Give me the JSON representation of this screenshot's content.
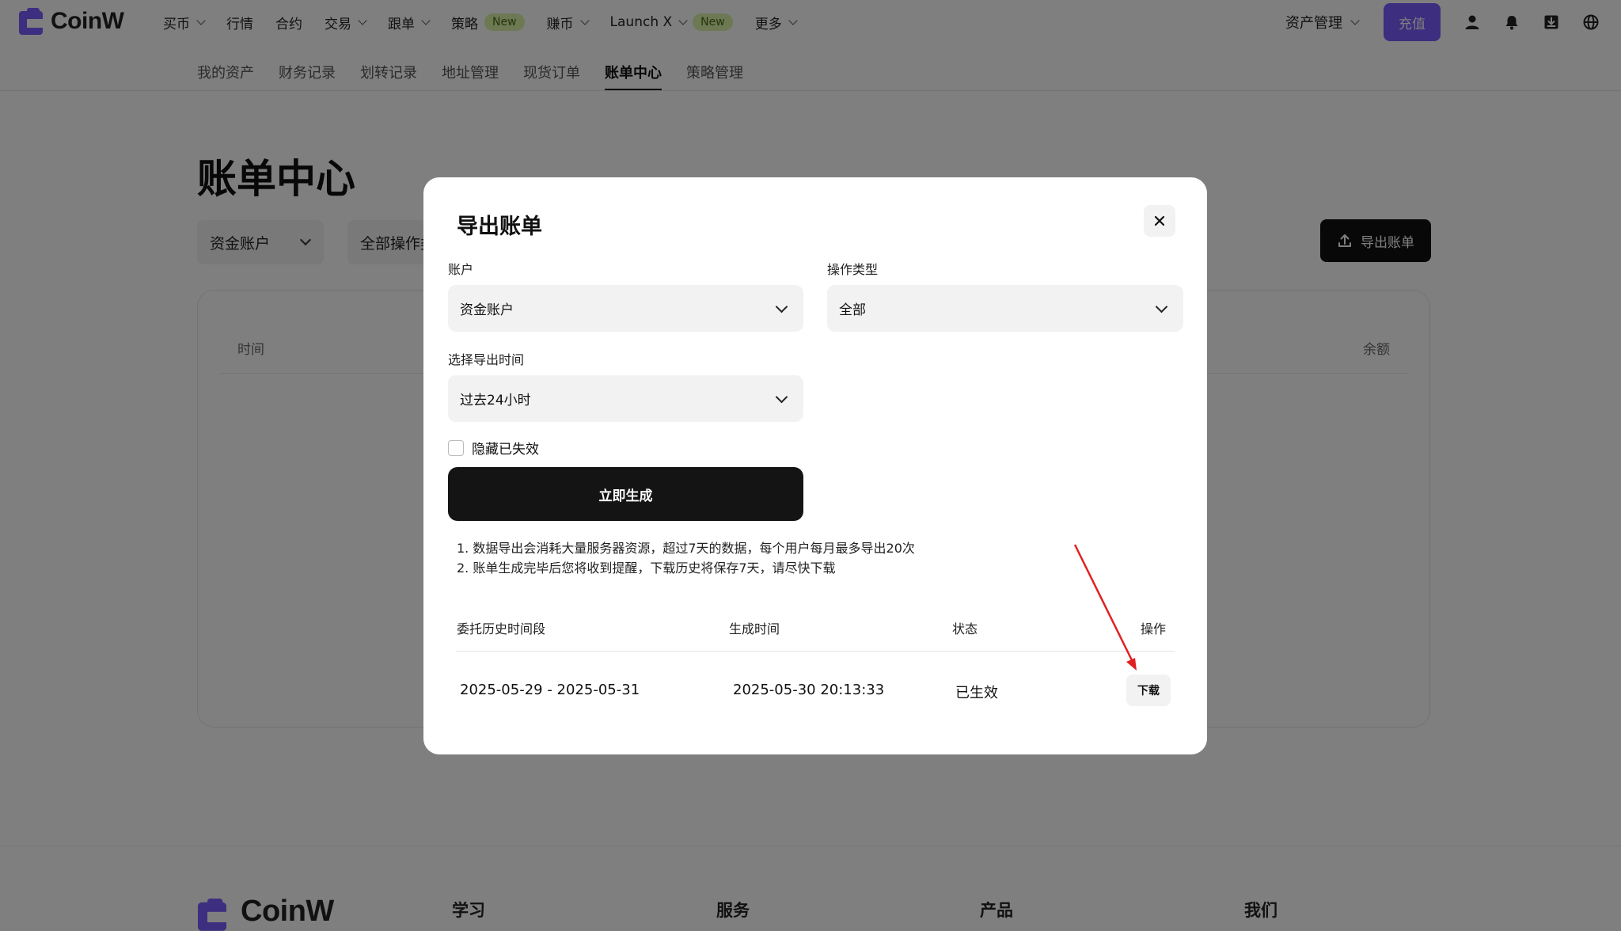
{
  "brand": {
    "name": "CoinW",
    "accent": "#7b5cff"
  },
  "topnav": {
    "items": [
      {
        "label": "买币",
        "dropdown": true
      },
      {
        "label": "行情",
        "dropdown": false
      },
      {
        "label": "合约",
        "dropdown": false
      },
      {
        "label": "交易",
        "dropdown": true
      },
      {
        "label": "跟单",
        "dropdown": true
      },
      {
        "label": "策略",
        "dropdown": false,
        "badge": "New"
      },
      {
        "label": "赚币",
        "dropdown": true
      },
      {
        "label": "Launch X",
        "dropdown": true,
        "badge": "New"
      },
      {
        "label": "更多",
        "dropdown": true
      }
    ],
    "asset_management": "资产管理",
    "deposit": "充值",
    "icons": [
      "user-icon",
      "bell-icon",
      "download-app-icon",
      "globe-icon"
    ]
  },
  "subnav": {
    "items": [
      "我的资产",
      "财务记录",
      "划转记录",
      "地址管理",
      "现货订单",
      "账单中心",
      "策略管理"
    ],
    "active": "账单中心"
  },
  "page": {
    "title": "账单中心",
    "filter_account": "资金账户",
    "filter_operation": "全部操作类型",
    "export_button": "导出账单",
    "table_headers": {
      "first": "时间",
      "last": "余额"
    }
  },
  "footer": {
    "logo": "CoinW",
    "columns": [
      "学习",
      "服务",
      "产品",
      "我们"
    ]
  },
  "modal": {
    "title": "导出账单",
    "account_label": "账户",
    "account_value": "资金账户",
    "operation_label": "操作类型",
    "operation_value": "全部",
    "time_label": "选择导出时间",
    "time_value": "过去24小时",
    "hide_expired_label": "隐藏已失效",
    "generate_button": "立即生成",
    "notes": [
      "1. 数据导出会消耗大量服务器资源，超过7天的数据，每个用户每月最多导出20次",
      "2. 账单生成完毕后您将收到提醒，下载历史将保存7天，请尽快下载"
    ],
    "history_headers": [
      "委托历史时间段",
      "生成时间",
      "状态",
      "操作"
    ],
    "history_rows": [
      {
        "period": "2025-05-29 - 2025-05-31",
        "generated": "2025-05-30 20:13:33",
        "status": "已生效",
        "action": "下载"
      }
    ]
  }
}
